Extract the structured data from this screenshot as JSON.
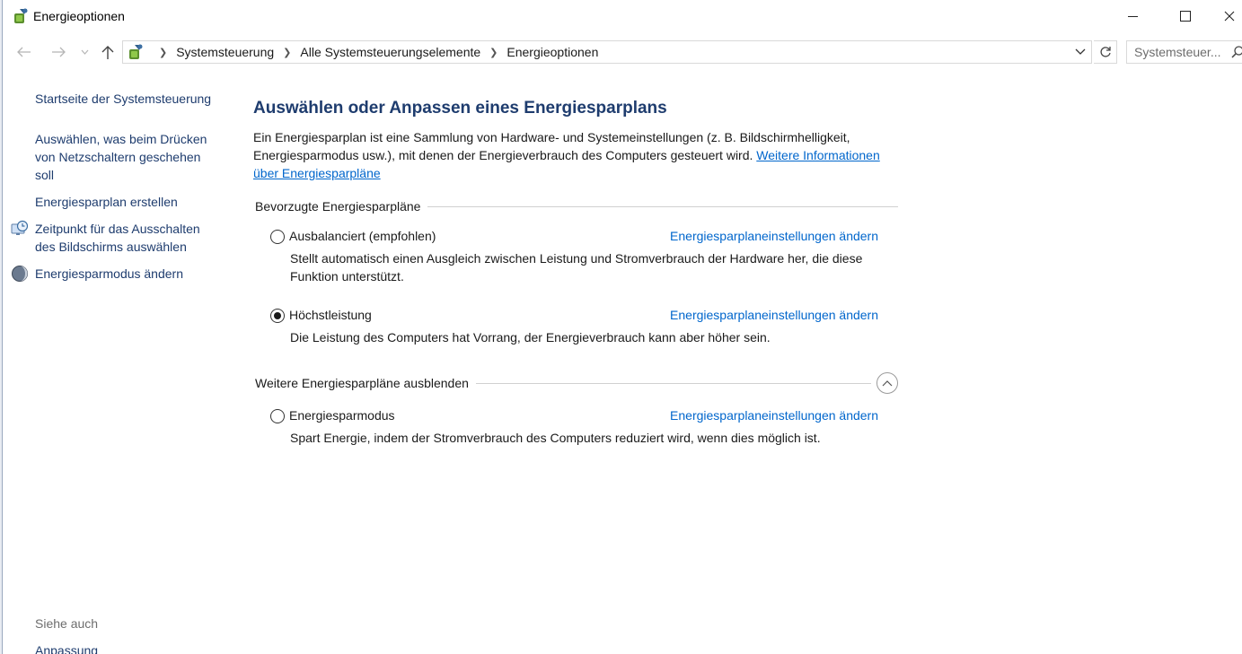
{
  "window": {
    "title": "Energieoptionen"
  },
  "address": {
    "breadcrumbs": [
      "Systemsteuerung",
      "Alle Systemsteuerungselemente",
      "Energieoptionen"
    ],
    "search_placeholder": "Systemsteuer..."
  },
  "sidebar": {
    "home": "Startseite der Systemsteuerung",
    "links": [
      {
        "label": "Auswählen, was beim Drücken\nvon Netzschaltern geschehen\nsoll"
      },
      {
        "label": "Energiesparplan erstellen"
      },
      {
        "label": "Zeitpunkt für das Ausschalten\ndes Bildschirms auswählen",
        "icon": "monitor-clock-icon"
      },
      {
        "label": "Energiesparmodus ändern",
        "icon": "moon-icon"
      }
    ],
    "see_also_heading": "Siehe auch",
    "see_also": [
      "Anpassung"
    ]
  },
  "main": {
    "title": "Auswählen oder Anpassen eines Energiesparplans",
    "intro_text": "Ein Energiesparplan ist eine Sammlung von Hardware- und Systemeinstellungen (z. B. Bildschirmhelligkeit, Energiesparmodus usw.), mit denen der Energieverbrauch des Computers gesteuert wird. ",
    "intro_link": "Weitere Informationen über Energiesparpläne",
    "preferred_heading": "Bevorzugte Energiesparpläne",
    "more_heading": "Weitere Energiesparpläne ausblenden",
    "plans": [
      {
        "name": "Ausbalanciert (empfohlen)",
        "link": "Energiesparplaneinstellungen ändern",
        "description": "Stellt automatisch einen Ausgleich zwischen Leistung und Stromverbrauch der Hardware her, die diese Funktion unterstützt.",
        "selected": false
      },
      {
        "name": "Höchstleistung",
        "link": "Energiesparplaneinstellungen ändern",
        "description": "Die Leistung des Computers hat Vorrang, der Energieverbrauch kann aber höher sein.",
        "selected": true
      },
      {
        "name": "Energiesparmodus",
        "link": "Energiesparplaneinstellungen ändern",
        "description": "Spart Energie, indem der Stromverbrauch des Computers reduziert wird, wenn dies möglich ist.",
        "selected": false
      }
    ]
  }
}
